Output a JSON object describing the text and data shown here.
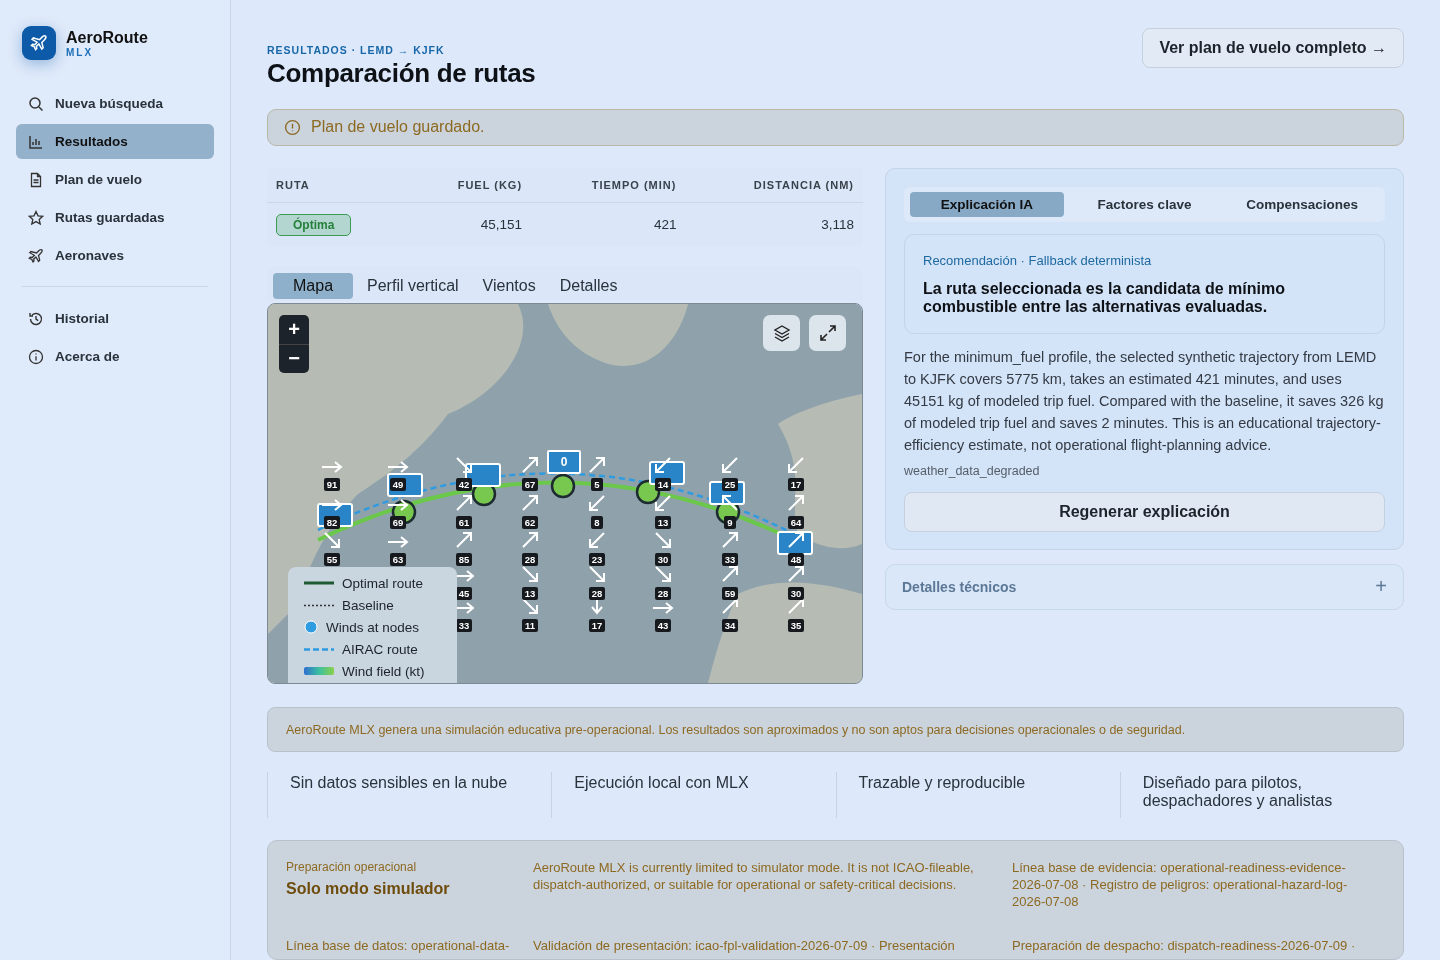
{
  "sidebar": {
    "brand": {
      "name": "AeroRoute",
      "sub": "MLX"
    },
    "groups": [
      [
        {
          "label": "Nueva búsqueda",
          "kind": "search",
          "selected": false
        },
        {
          "label": "Resultados",
          "kind": "chart",
          "selected": true
        },
        {
          "label": "Plan de vuelo",
          "kind": "doc",
          "selected": false
        },
        {
          "label": "Rutas guardadas",
          "kind": "star",
          "selected": false
        },
        {
          "label": "Aeronaves",
          "kind": "plane",
          "selected": false
        }
      ],
      [
        {
          "label": "Historial",
          "kind": "history",
          "selected": false
        },
        {
          "label": "Acerca de",
          "kind": "info",
          "selected": false
        }
      ]
    ]
  },
  "header": {
    "breadcrumb": "RESULTADOS · LEMD → KJFK",
    "title": "Comparación de rutas",
    "action": "Ver plan de vuelo completo →"
  },
  "alert": {
    "text": "Plan de vuelo guardado."
  },
  "table": {
    "columns": [
      "RUTA",
      "FUEL (KG)",
      "TIEMPO (MIN)",
      "DISTANCIA (NM)"
    ],
    "rows": [
      {
        "route": "Óptima",
        "fuel": "45,151",
        "time": "421",
        "distance": "3,118"
      }
    ]
  },
  "map_tabs": [
    {
      "label": "Mapa",
      "selected": true
    },
    {
      "label": "Perfil vertical",
      "selected": false
    },
    {
      "label": "Vientos",
      "selected": false
    },
    {
      "label": "Detalles",
      "selected": false
    }
  ],
  "map": {
    "zoom_in": "+",
    "zoom_out": "−",
    "node_label": "0",
    "wind_columns": [
      [
        {
          "speed": "91",
          "kind": "e"
        },
        {
          "speed": "82",
          "kind": "e"
        },
        {
          "speed": "55",
          "kind": "se"
        }
      ],
      [
        {
          "speed": "49",
          "kind": "e"
        },
        {
          "speed": "69",
          "kind": "e"
        },
        {
          "speed": "63",
          "kind": "e"
        }
      ],
      [
        {
          "speed": "42",
          "kind": "se"
        },
        {
          "speed": "61",
          "kind": "ne"
        },
        {
          "speed": "85",
          "kind": "ne"
        },
        {
          "speed": "45",
          "kind": "e"
        },
        {
          "speed": "33",
          "kind": "e"
        }
      ],
      [
        {
          "speed": "67",
          "kind": "ne"
        },
        {
          "speed": "62",
          "kind": "ne"
        },
        {
          "speed": "28",
          "kind": "ne"
        },
        {
          "speed": "13",
          "kind": "se"
        },
        {
          "speed": "11",
          "kind": "se"
        }
      ],
      [
        {
          "speed": "5",
          "kind": "ne"
        },
        {
          "speed": "8",
          "kind": "sw"
        },
        {
          "speed": "23",
          "kind": "sw"
        },
        {
          "speed": "28",
          "kind": "se"
        },
        {
          "speed": "17",
          "kind": "s"
        }
      ],
      [
        {
          "speed": "14",
          "kind": "sw"
        },
        {
          "speed": "13",
          "kind": "sw"
        },
        {
          "speed": "30",
          "kind": "se"
        },
        {
          "speed": "28",
          "kind": "se"
        },
        {
          "speed": "43",
          "kind": "e"
        }
      ],
      [
        {
          "speed": "25",
          "kind": "sw"
        },
        {
          "speed": "9",
          "kind": "nw"
        },
        {
          "speed": "33",
          "kind": "ne"
        },
        {
          "speed": "59",
          "kind": "ne"
        },
        {
          "speed": "34",
          "kind": "ne"
        }
      ],
      [
        {
          "speed": "17",
          "kind": "sw"
        },
        {
          "speed": "64",
          "kind": "ne"
        },
        {
          "speed": "48",
          "kind": "ne"
        },
        {
          "speed": "30",
          "kind": "ne"
        },
        {
          "speed": "35",
          "kind": "ne"
        }
      ]
    ],
    "legend": [
      {
        "kind": "solid",
        "label": "Optimal route"
      },
      {
        "kind": "dotted",
        "label": "Baseline"
      },
      {
        "kind": "dot",
        "label": "Winds at nodes"
      },
      {
        "kind": "dashed",
        "label": "AIRAC route"
      },
      {
        "kind": "gradient",
        "label": "Wind field (kt)"
      }
    ]
  },
  "explain": {
    "tabs": [
      {
        "label": "Explicación IA",
        "selected": true
      },
      {
        "label": "Factores clave",
        "selected": false
      },
      {
        "label": "Compensaciones",
        "selected": false
      }
    ],
    "kicker": "Recomendación · Fallback determinista",
    "headline": "La ruta seleccionada es la candidata de mínimo combustible entre las alternativas evaluadas.",
    "body": "For the minimum_fuel profile, the selected synthetic trajectory from LEMD to KJFK covers 5775 km, takes an estimated 421 minutes, and uses 45151 kg of modeled trip fuel. Compared with the baseline, it saves 326 kg of modeled trip fuel and saves 2 minutes. This is an educational trajectory-efficiency estimate, not operational flight-planning advice.",
    "flag": "weather_data_degraded",
    "button": "Regenerar explicación"
  },
  "technical": {
    "title": "Detalles técnicos",
    "toggle": "+",
    "expanded": false
  },
  "disclaimer": "AeroRoute MLX genera una simulación educativa pre-operacional. Los resultados son aproximados y no son aptos para decisiones operacionales o de seguridad.",
  "features": [
    "Sin datos sensibles en la nube",
    "Ejecución local con MLX",
    "Trazable y reproducible",
    "Diseñado para pilotos, despachadores y analistas"
  ],
  "readiness": {
    "kicker": "Preparación operacional",
    "title": "Solo modo simulador",
    "text": "AeroRoute MLX is currently limited to simulator mode. It is not ICAO-fileable, dispatch-authorized, or suitable for operational or safety-critical decisions.",
    "evidence": "Línea base de evidencia: operational-readiness-evidence-2026-07-08 · Registro de peligros: operational-hazard-log-2026-07-08",
    "row2": [
      "Línea base de datos: operational-data-",
      "Validación de presentación: icao-fpl-validation-2026-07-09 · Presentación",
      "Preparación de despacho: dispatch-readiness-2026-07-09 ·"
    ]
  }
}
